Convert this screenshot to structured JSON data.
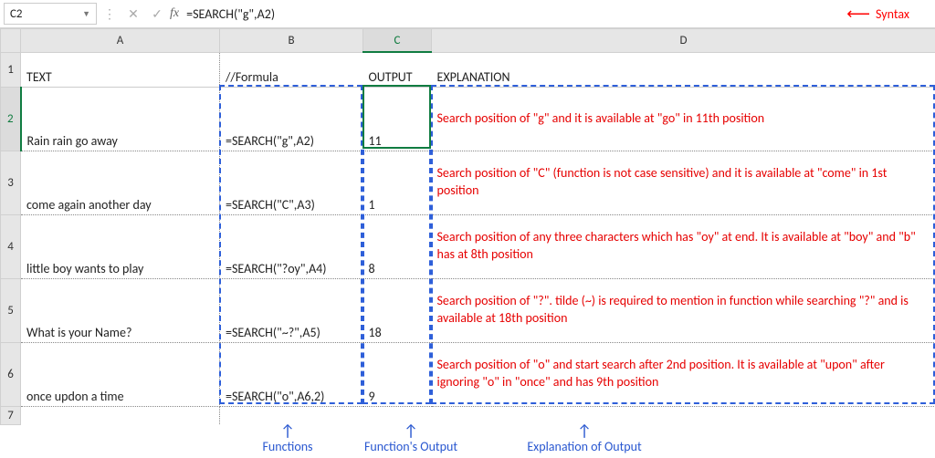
{
  "namebox": "C2",
  "formula": "=SEARCH(\"g\",A2)",
  "syntax_label": "Syntax",
  "columns": [
    "A",
    "B",
    "C",
    "D"
  ],
  "row_numbers": [
    "1",
    "2",
    "3",
    "4",
    "5",
    "6",
    "7"
  ],
  "headers": {
    "A": "TEXT",
    "B": "//Formula",
    "C": "OUTPUT",
    "D": "EXPLANATION"
  },
  "rows": [
    {
      "text": "Rain rain go away",
      "formula": "=SEARCH(\"g\",A2)",
      "output": "11",
      "explanation": "Search position of \"g\" and it is available at \"go\" in 11th position"
    },
    {
      "text": "come again another day",
      "formula": "=SEARCH(\"C\",A3)",
      "output": "1",
      "explanation": "Search position of  \"C\" (function is not case sensitive) and it is available at \"come\" in 1st position"
    },
    {
      "text": "little boy wants to play",
      "formula": "=SEARCH(\"?oy\",A4)",
      "output": "8",
      "explanation": "Search position of any three characters which has \"oy\" at end. It is available at \"boy\" and \"b\" has at 8th position"
    },
    {
      "text": "What is your Name?",
      "formula": "=SEARCH(\"~?\",A5)",
      "output": "18",
      "explanation": "Search position of \"?\". tilde (~) is required to mention in function while searching \"?\" and is available at 18th position"
    },
    {
      "text": "once updon a time",
      "formula": "=SEARCH(\"o\",A6,2)",
      "output": "9",
      "explanation": "Search position of \"o\" and start search after 2nd position. It is available at \"upon\" after ignoring \"o\" in \"once\" and has 9th position"
    }
  ],
  "annotations": {
    "functions": "Functions",
    "functions_output": "Function's Output",
    "explanation_output": "Explanation of Output"
  }
}
